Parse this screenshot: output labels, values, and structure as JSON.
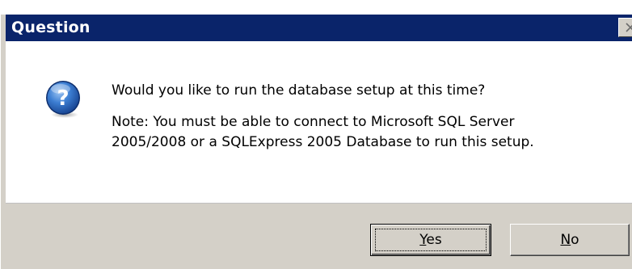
{
  "dialog": {
    "title": "Question",
    "close_icon": "close-icon",
    "icon": "question-icon",
    "message_line1": "Would you like to run the database setup at this time?",
    "message_line2": "Note: You must be able to connect to Microsoft SQL Server",
    "message_line3": "2005/2008 or a SQLExpress 2005 Database to run this setup."
  },
  "buttons": {
    "yes_mnemonic": "Y",
    "yes_rest": "es",
    "no_mnemonic": "N",
    "no_rest": "o"
  },
  "colors": {
    "titlebar": "#0a246a",
    "face": "#d4d0c8",
    "icon_blue": "#1f5fb7"
  }
}
